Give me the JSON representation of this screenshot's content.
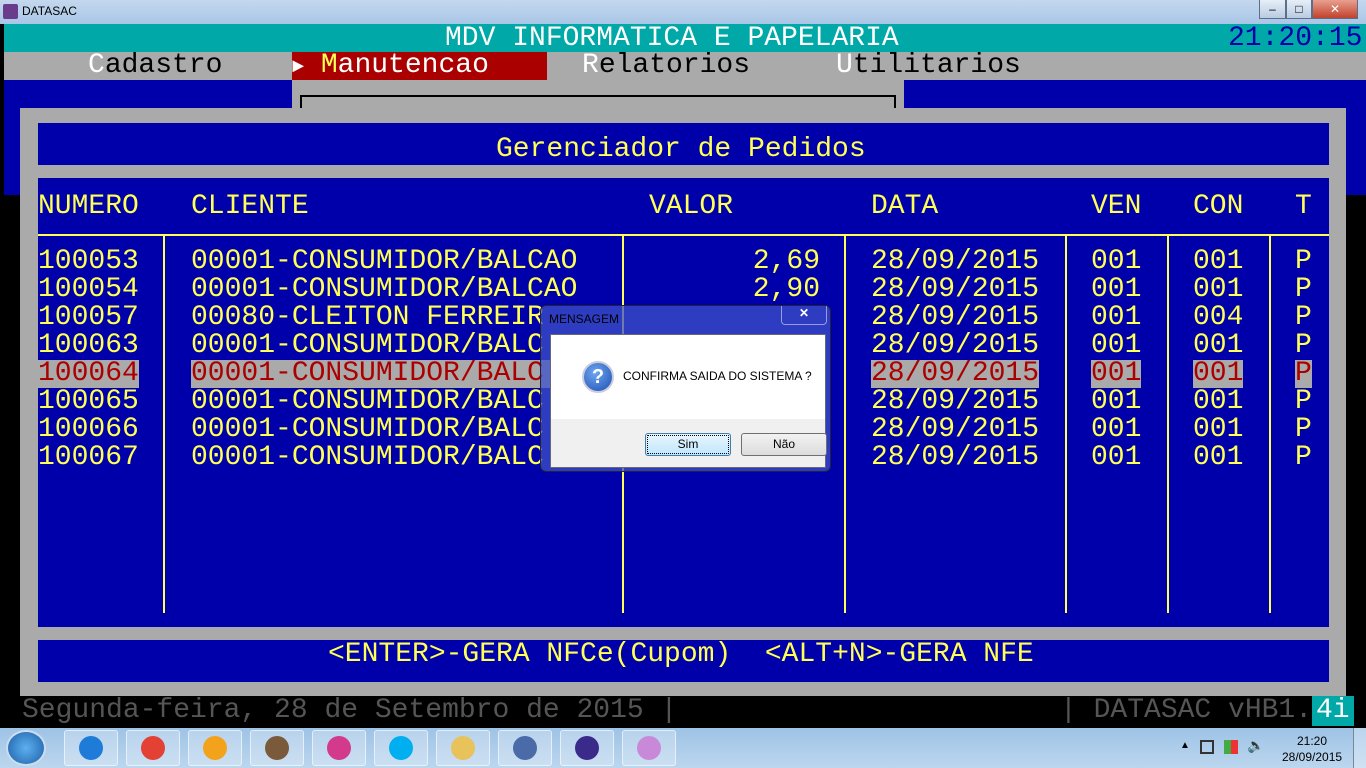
{
  "window": {
    "title": "DATASAC",
    "minimize": "–",
    "maximize": "□",
    "close": "✕"
  },
  "header": {
    "title": "MDV INFORMATICA E PAPELARIA",
    "clock": "21:20:15"
  },
  "menu": [
    {
      "hot": "C",
      "rest": "adastro"
    },
    {
      "hot": "M",
      "rest": "anutencao",
      "active": true
    },
    {
      "hot": "R",
      "rest": "elatorios"
    },
    {
      "hot": "U",
      "rest": "tilitarios"
    }
  ],
  "menu_arrow": "►",
  "panel": {
    "title": "Gerenciador de Pedidos",
    "columns": [
      "NUMERO",
      "CLIENTE",
      "VALOR",
      "DATA",
      "VEN",
      "CON",
      "T"
    ],
    "rows": [
      {
        "numero": "100053",
        "cliente": "00001-CONSUMIDOR/BALCAO",
        "valor": "2,69",
        "data": "28/09/2015",
        "ven": "001",
        "con": "001",
        "t": "P"
      },
      {
        "numero": "100054",
        "cliente": "00001-CONSUMIDOR/BALCAO",
        "valor": "2,90",
        "data": "28/09/2015",
        "ven": "001",
        "con": "001",
        "t": "P"
      },
      {
        "numero": "100057",
        "cliente": "00080-CLEITON FERREIR",
        "valor": "",
        "data": "28/09/2015",
        "ven": "001",
        "con": "004",
        "t": "P"
      },
      {
        "numero": "100063",
        "cliente": "00001-CONSUMIDOR/BALC",
        "valor": "",
        "data": "28/09/2015",
        "ven": "001",
        "con": "001",
        "t": "P"
      },
      {
        "numero": "100064",
        "cliente": "00001-CONSUMIDOR/BALC",
        "valor": "",
        "data": "28/09/2015",
        "ven": "001",
        "con": "001",
        "t": "P",
        "selected": true
      },
      {
        "numero": "100065",
        "cliente": "00001-CONSUMIDOR/BALC",
        "valor": "",
        "data": "28/09/2015",
        "ven": "001",
        "con": "001",
        "t": "P"
      },
      {
        "numero": "100066",
        "cliente": "00001-CONSUMIDOR/BALC",
        "valor": "",
        "data": "28/09/2015",
        "ven": "001",
        "con": "001",
        "t": "P"
      },
      {
        "numero": "100067",
        "cliente": "00001-CONSUMIDOR/BALC",
        "valor": "",
        "data": "28/09/2015",
        "ven": "001",
        "con": "001",
        "t": "P"
      }
    ],
    "footer": "<ENTER>-GERA NFCe(Cupom)  <ALT+N>-GERA NFE"
  },
  "status": {
    "date": "Segunda-feira, 28 de Setembro de 2015 |",
    "version": "| DATASAC vHB1.",
    "version_suffix": "4i"
  },
  "dialog": {
    "title": "MENSAGEM",
    "message": "CONFIRMA SAIDA DO SISTEMA ?",
    "yes": "Sim",
    "no": "Não",
    "icon": "question-icon"
  },
  "taskbar": {
    "time": "21:20",
    "date": "28/09/2015",
    "apps": [
      "start",
      "internet-explorer",
      "chrome",
      "outlook",
      "tool",
      "app-s",
      "skype",
      "file-explorer",
      "network",
      "mdv",
      "paint"
    ]
  }
}
